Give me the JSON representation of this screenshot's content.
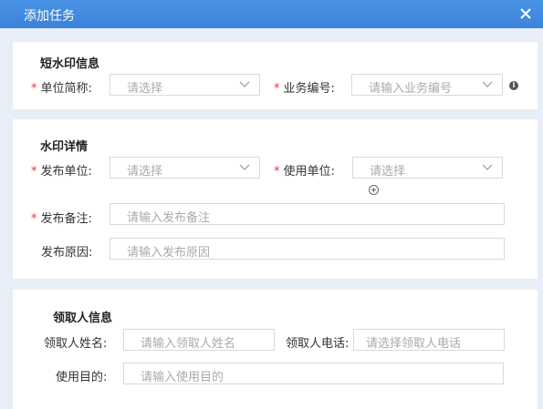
{
  "dialog": {
    "title": "添加任务"
  },
  "watermark_info": {
    "title": "短水印信息",
    "unit_abbr": {
      "label": "单位简称:",
      "placeholder": "请选择"
    },
    "business_no": {
      "label": "业务编号:",
      "placeholder": "请输入业务编号"
    }
  },
  "watermark_detail": {
    "title": "水印详情",
    "publish_unit": {
      "label": "发布单位:",
      "placeholder": "请选择"
    },
    "use_unit": {
      "label": "使用单位:",
      "placeholder": "请选择"
    },
    "publish_note": {
      "label": "发布备注:",
      "placeholder": "请输入发布备注"
    },
    "publish_reason": {
      "label": "发布原因:",
      "placeholder": "请输入发布原因"
    }
  },
  "receiver_info": {
    "title": "领取人信息",
    "name": {
      "label": "领取人姓名:",
      "placeholder": "请输入领取人姓名"
    },
    "phone": {
      "label": "领取人电话:",
      "placeholder": "请选择领取人电话"
    },
    "purpose": {
      "label": "使用目的:",
      "placeholder": "请输入使用目的"
    }
  },
  "required_mark": "*",
  "colors": {
    "title_bar": "#3b82d8",
    "required": "#e0383e",
    "page_bg": "#e8eef7"
  },
  "icons": {
    "close": "close-icon",
    "info": "info-icon",
    "dropdown": "chevron-down-icon",
    "add": "plus-circle-icon"
  }
}
